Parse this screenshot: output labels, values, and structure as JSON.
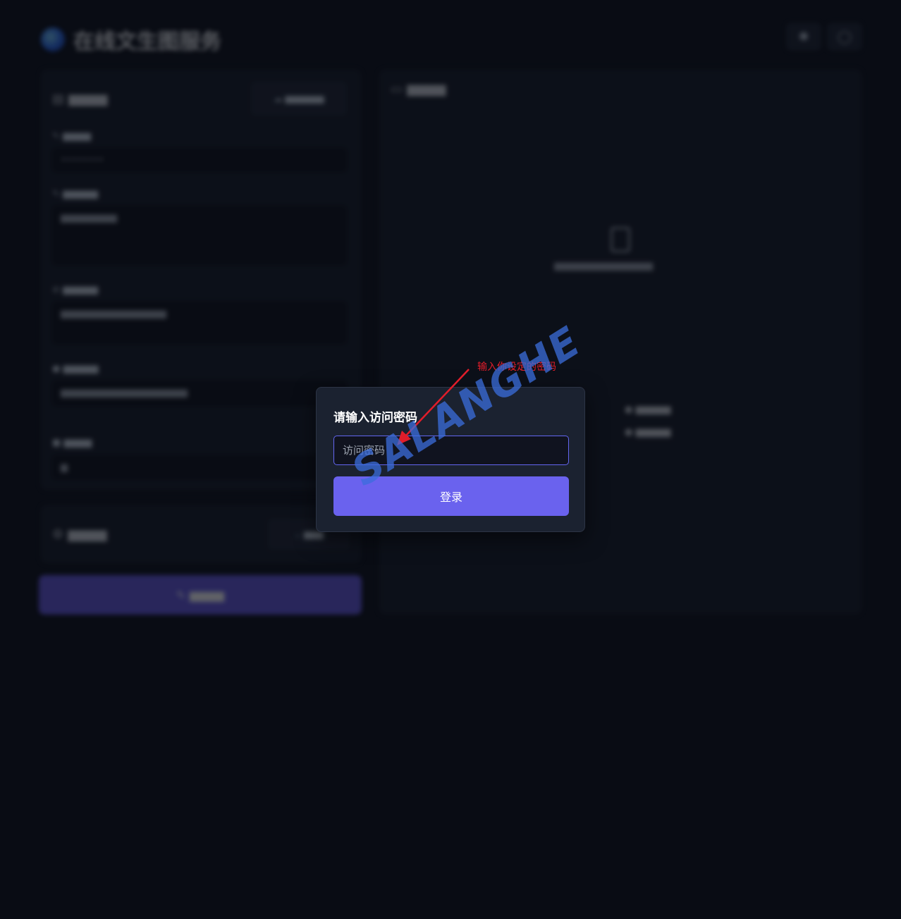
{
  "app": {
    "title": "在线文生图服务"
  },
  "login_modal": {
    "title": "请输入访问密码",
    "password_placeholder": "访问密码",
    "login_label": "登录"
  },
  "annotation": {
    "text": "输入你设定的密码",
    "color": "#e11d2a"
  },
  "watermark": {
    "text": "SALANGHE"
  },
  "colors": {
    "accent": "#6a62ee",
    "background": "#0b0e17",
    "modal_bg": "#1b2230",
    "input_border": "#6366f1"
  }
}
